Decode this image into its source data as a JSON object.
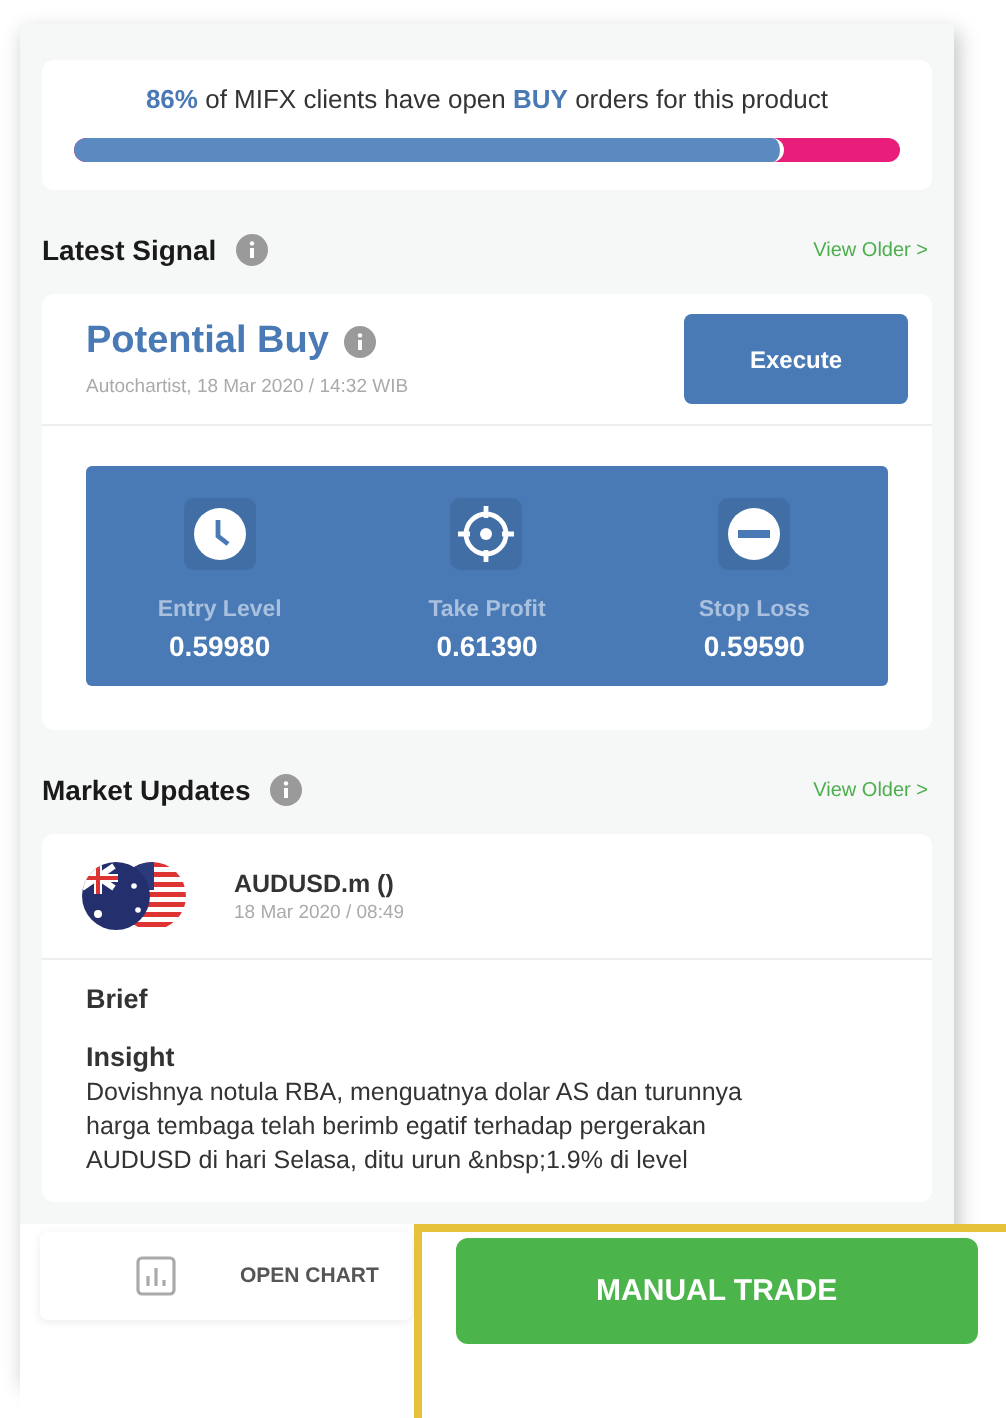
{
  "sentiment": {
    "text": "**86%** of MIFX clients have open **BUY** orders for this product",
    "level": 0.86
  },
  "latest_signal": {
    "heading": "Latest Signal",
    "link": "View Older >",
    "title": "Potential Buy",
    "source": "Autochartist, 18 Mar 2020 / 14:32 WIB",
    "button": "Execute",
    "levels": [
      {
        "kind": "entry",
        "label": "Entry Level",
        "value": "0.59980"
      },
      {
        "kind": "profit",
        "label": "Take Profit",
        "value": "0.61390"
      },
      {
        "kind": "stop",
        "label": "Stop Loss",
        "value": "0.59590"
      }
    ]
  },
  "market_updates": {
    "heading": "Market Updates",
    "link": "View Older >",
    "symbol": "AUDUSD.m ()",
    "date": "18 Mar 2020 / 08:49",
    "brief": "Brief",
    "insight": "Insight",
    "text": "Dovishnya notula RBA, menguatnya dolar AS dan turunnya harga tembaga telah berimb egatif terhadap pergerakan AUDUSD di hari Selasa, ditu urun &nbsp;1.9% di level"
  },
  "bottom_bar": {
    "open_chart": "OPEN CHART",
    "manual_trade": "MANUAL TRADE"
  }
}
